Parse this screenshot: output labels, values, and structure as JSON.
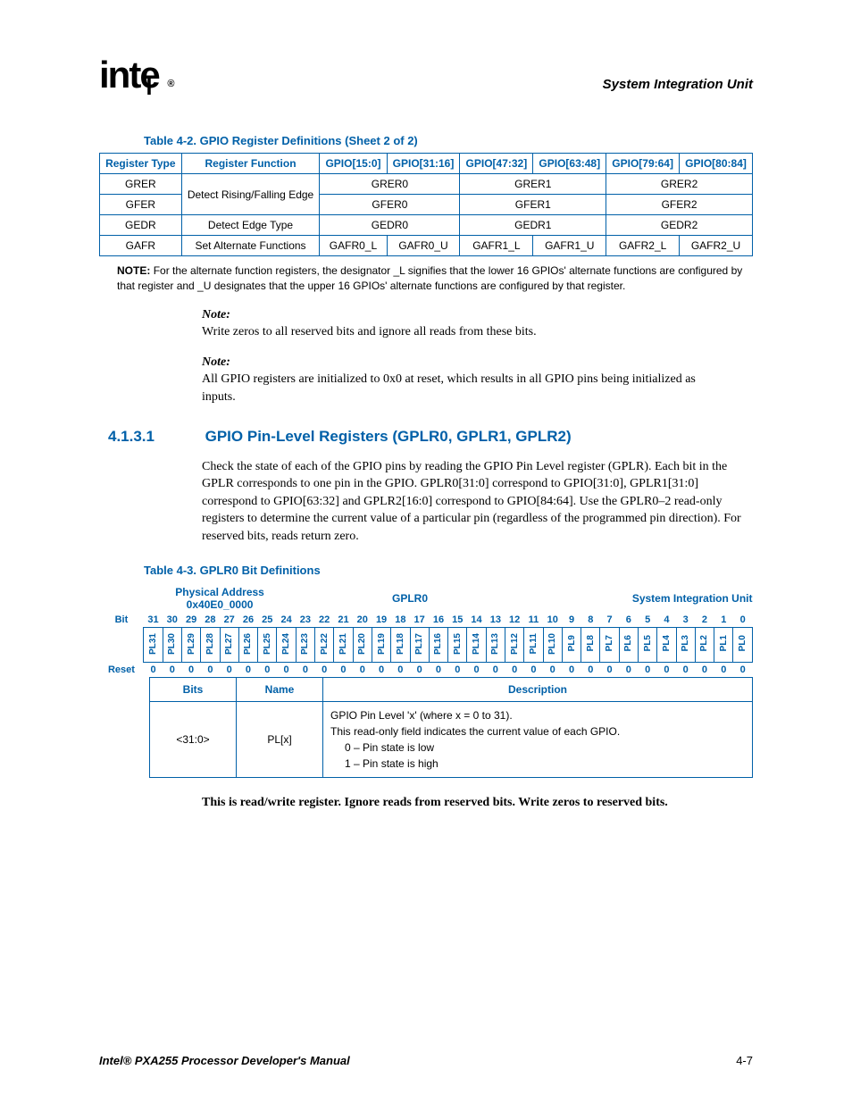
{
  "header": {
    "chapter": "System Integration Unit"
  },
  "table42": {
    "title": "Table 4-2. GPIO Register Definitions (Sheet 2 of 2)",
    "head": [
      "Register Type",
      "Register Function",
      "GPIO[15:0]",
      "GPIO[31:16]",
      "GPIO[47:32]",
      "GPIO[63:48]",
      "GPIO[79:64]",
      "GPIO[80:84]"
    ],
    "rows": [
      {
        "type": "GRER",
        "func": "Detect Rising/Falling Edge",
        "span2a": "GRER0",
        "span2b": "GRER1",
        "span2c": "GRER2",
        "rowspan_func": true
      },
      {
        "type": "GFER",
        "span2a": "GFER0",
        "span2b": "GFER1",
        "span2c": "GFER2"
      },
      {
        "type": "GEDR",
        "func": "Detect Edge Type",
        "span2a": "GEDR0",
        "span2b": "GEDR1",
        "span2c": "GEDR2"
      },
      {
        "type": "GAFR",
        "func": "Set Alternate Functions",
        "c": [
          "GAFR0_L",
          "GAFR0_U",
          "GAFR1_L",
          "GAFR1_U",
          "GAFR2_L",
          "GAFR2_U"
        ]
      }
    ],
    "note_label": "NOTE:",
    "note": "For the alternate function registers, the designator _L signifies that the lower 16 GPIOs' alternate functions are configured by that register and _U designates that the upper 16 GPIOs' alternate functions are configured by that register."
  },
  "notes": [
    {
      "label": "Note:",
      "text": "Write zeros to all reserved bits and ignore all reads from these bits."
    },
    {
      "label": "Note:",
      "text": "All GPIO registers are initialized to 0x0 at reset, which results in all GPIO pins being initialized as inputs."
    }
  ],
  "section": {
    "num": "4.1.3.1",
    "title": "GPIO Pin-Level Registers (GPLR0, GPLR1, GPLR2)",
    "body": "Check the state of each of the GPIO pins by reading the GPIO Pin Level register (GPLR). Each bit in the GPLR corresponds to one pin in the GPIO. GPLR0[31:0] correspond to GPIO[31:0], GPLR1[31:0] correspond to GPIO[63:32] and GPLR2[16:0] correspond to GPIO[84:64]. Use the GPLR0–2 read-only registers to determine the current value of a particular pin (regardless of the programmed pin direction). For reserved bits, reads return zero."
  },
  "table43": {
    "title": "Table 4-3. GPLR0 Bit Definitions",
    "phys_addr_label": "Physical Address",
    "phys_addr": "0x40E0_0000",
    "regname": "GPLR0",
    "unit": "System Integration Unit",
    "bit_label": "Bit",
    "reset_label": "Reset",
    "bits": [
      "31",
      "30",
      "29",
      "28",
      "27",
      "26",
      "25",
      "24",
      "23",
      "22",
      "21",
      "20",
      "19",
      "18",
      "17",
      "16",
      "15",
      "14",
      "13",
      "12",
      "11",
      "10",
      "9",
      "8",
      "7",
      "6",
      "5",
      "4",
      "3",
      "2",
      "1",
      "0"
    ],
    "fields": [
      "PL31",
      "PL30",
      "PL29",
      "PL28",
      "PL27",
      "PL26",
      "PL25",
      "PL24",
      "PL23",
      "PL22",
      "PL21",
      "PL20",
      "PL19",
      "PL18",
      "PL17",
      "PL16",
      "PL15",
      "PL14",
      "PL13",
      "PL12",
      "PL11",
      "PL10",
      "PL9",
      "PL8",
      "PL7",
      "PL6",
      "PL5",
      "PL4",
      "PL3",
      "PL2",
      "PL1",
      "PL0"
    ],
    "reset": [
      "0",
      "0",
      "0",
      "0",
      "0",
      "0",
      "0",
      "0",
      "0",
      "0",
      "0",
      "0",
      "0",
      "0",
      "0",
      "0",
      "0",
      "0",
      "0",
      "0",
      "0",
      "0",
      "0",
      "0",
      "0",
      "0",
      "0",
      "0",
      "0",
      "0",
      "0",
      "0"
    ],
    "desc_head": {
      "bits": "Bits",
      "name": "Name",
      "desc": "Description"
    },
    "desc_row": {
      "bits": "<31:0>",
      "name": "PL[x]",
      "line1": "GPIO Pin Level 'x' (where x = 0 to 31).",
      "line2": "This read-only field indicates the current value of each GPIO.",
      "line3": "0 – Pin state is low",
      "line4": "1 – Pin state is high"
    }
  },
  "bold_line": "This is read/write register. Ignore reads from reserved bits. Write zeros to reserved bits.",
  "footer": {
    "left": "Intel® PXA255 Processor Developer's Manual",
    "right": "4-7"
  }
}
